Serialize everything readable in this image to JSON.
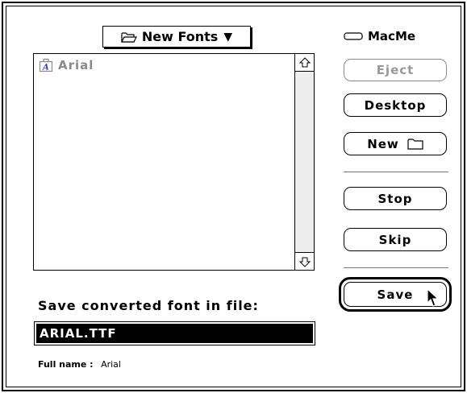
{
  "folder_popup": {
    "label": "New Fonts",
    "arrow": "▼",
    "icon": "open-folder-icon"
  },
  "file_list": {
    "items": [
      {
        "label": "Arial",
        "icon": "font-suitcase-icon"
      }
    ]
  },
  "volume": {
    "label": "MacMe",
    "icon": "disk-icon"
  },
  "buttons": {
    "eject": "Eject",
    "desktop": "Desktop",
    "new": "New",
    "stop": "Stop",
    "skip": "Skip",
    "save": "Save"
  },
  "save_prompt": "Save converted font in file:",
  "filename": "ARIAL.TTF",
  "fullname": {
    "label": "Full name :",
    "value": "Arial"
  },
  "colors": {
    "selection": "#000000",
    "disabled_text": "#999999",
    "background": "#ffffff"
  }
}
